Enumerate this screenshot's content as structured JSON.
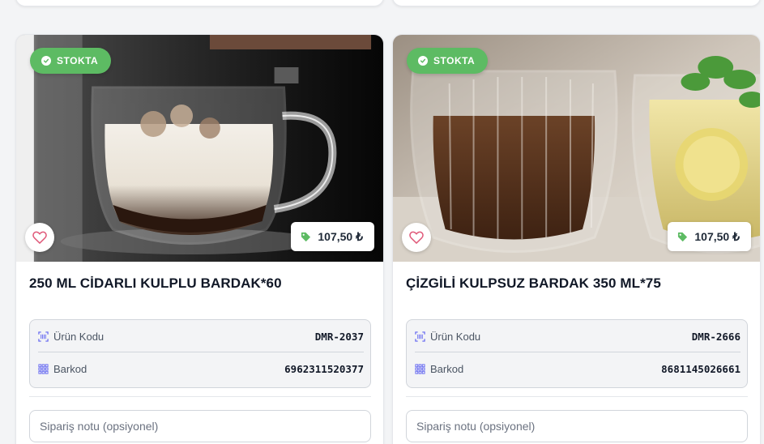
{
  "products": [
    {
      "stock_label": "STOKTA",
      "price": "107,50 ₺",
      "title": "250 ML CİDARLI KULPLU BARDAK*60",
      "code_label": "Ürün Kodu",
      "code_value": "DMR-2037",
      "barcode_label": "Barkod",
      "barcode_value": "6962311520377",
      "note_placeholder": "Sipariş notu (opsiyonel)"
    },
    {
      "stock_label": "STOKTA",
      "price": "107,50 ₺",
      "title": "ÇİZGİLİ KULPSUZ BARDAK 350 ML*75",
      "code_label": "Ürün Kodu",
      "code_value": "DMR-2666",
      "barcode_label": "Barkod",
      "barcode_value": "8681145026661",
      "note_placeholder": "Sipariş notu (opsiyonel)"
    }
  ],
  "colors": {
    "stock_badge": "#5dbb63",
    "price_icon": "#5dbb63",
    "heart_icon": "#e05a7a",
    "info_icon": "#6366f1"
  },
  "icons": {
    "stock": "check-circle-icon",
    "favorite": "heart-icon",
    "price": "tag-icon",
    "code": "barcode-scan-icon",
    "barcode": "grid-icon"
  }
}
